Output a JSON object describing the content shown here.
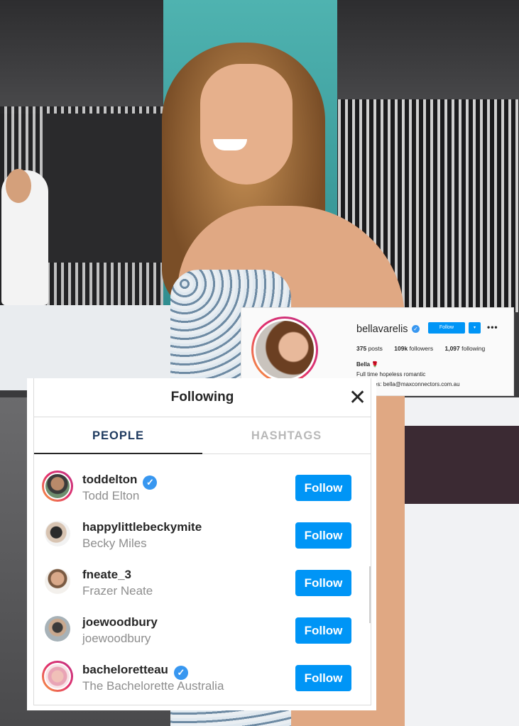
{
  "profile": {
    "username": "bellavarelis",
    "verified_mark": "✓",
    "follow_label": "Follow",
    "dropdown_icon": "▾",
    "more_icon": "•••",
    "posts_count": "375",
    "posts_label": "posts",
    "followers_count": "109k",
    "followers_label": "followers",
    "following_count": "1,097",
    "following_label": "following",
    "bio_name": "Bella 🌹",
    "bio_line1": "Full time hopeless romantic",
    "bio_line2": "Enquiries: bella@maxconnectors.com.au"
  },
  "modal": {
    "title": "Following",
    "close_icon": "✕",
    "tabs": [
      {
        "label": "PEOPLE",
        "active": true
      },
      {
        "label": "HASHTAGS",
        "active": false
      }
    ],
    "follow_label": "Follow",
    "users": [
      {
        "username": "toddelton",
        "full_name": "Todd Elton",
        "verified": true,
        "story_ring": true
      },
      {
        "username": "happylittlebeckymite",
        "full_name": "Becky Miles",
        "verified": false,
        "story_ring": false
      },
      {
        "username": "fneate_3",
        "full_name": "Frazer Neate",
        "verified": false,
        "story_ring": false
      },
      {
        "username": "joewoodbury",
        "full_name": "joewoodbury",
        "verified": false,
        "story_ring": false
      },
      {
        "username": "bacheloretteau",
        "full_name": "The Bachelorette Australia",
        "verified": true,
        "story_ring": true
      }
    ]
  },
  "colors": {
    "accent": "#0095f6",
    "verified": "#3897f0",
    "story_ring_start": "#f9a23c",
    "story_ring_end": "#c13584"
  }
}
